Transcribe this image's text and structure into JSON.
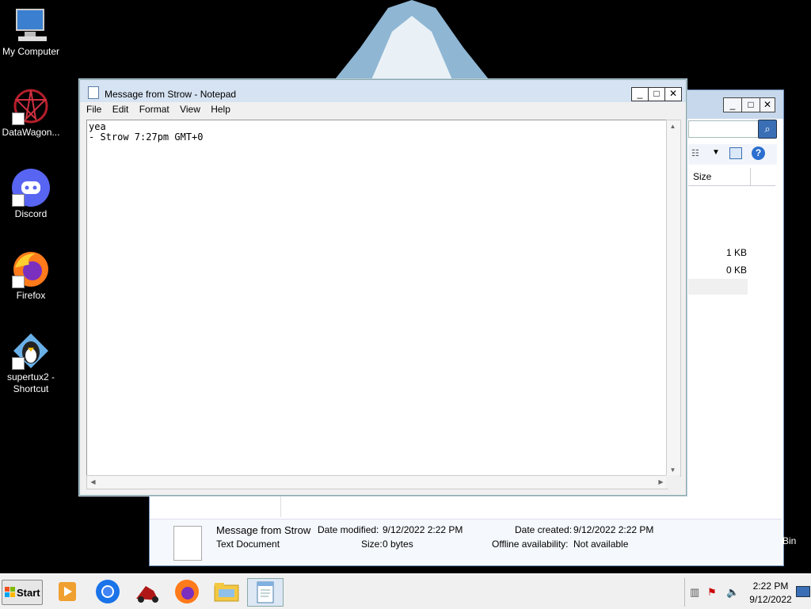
{
  "desktop": {
    "icons": [
      {
        "label": "My Computer",
        "icon": "my-computer-icon"
      },
      {
        "label": "DataWagon...",
        "icon": "datawagon-icon"
      },
      {
        "label": "Discord",
        "icon": "discord-icon"
      },
      {
        "label": "Firefox",
        "icon": "firefox-icon"
      },
      {
        "label": "supertux2 - Shortcut",
        "icon": "supertux-icon"
      }
    ],
    "recycle_bin_partial_label": "Bin"
  },
  "notepad": {
    "title": "Message from Strow - Notepad",
    "menu": [
      "File",
      "Edit",
      "Format",
      "View",
      "Help"
    ],
    "content": "yea\n- Strow 7:27pm GMT+0",
    "controls": {
      "minimize": "_",
      "maximize": "□",
      "close": "✕"
    }
  },
  "explorer": {
    "column_header": "Size",
    "sizes": [
      "1 KB",
      "0 KB"
    ],
    "details": {
      "name": "Message from Strow",
      "type": "Text Document",
      "date_modified_label": "Date modified:",
      "date_modified": "9/12/2022 2:22 PM",
      "size_label": "Size:",
      "size": "0 bytes",
      "date_created_label": "Date created:",
      "date_created": "9/12/2022 2:22 PM",
      "offline_label": "Offline availability:",
      "offline": "Not available"
    }
  },
  "taskbar": {
    "start_label": "Start",
    "apps": [
      "media-player-icon",
      "chrome-icon",
      "game-icon",
      "firefox-icon",
      "file-explorer-icon",
      "notepad-icon"
    ],
    "clock_time": "2:22 PM",
    "clock_date": "9/12/2022"
  },
  "colors": {
    "titlebar": "#d6e3f2",
    "taskbar": "#f0f0f0",
    "desktop": "#000000"
  }
}
